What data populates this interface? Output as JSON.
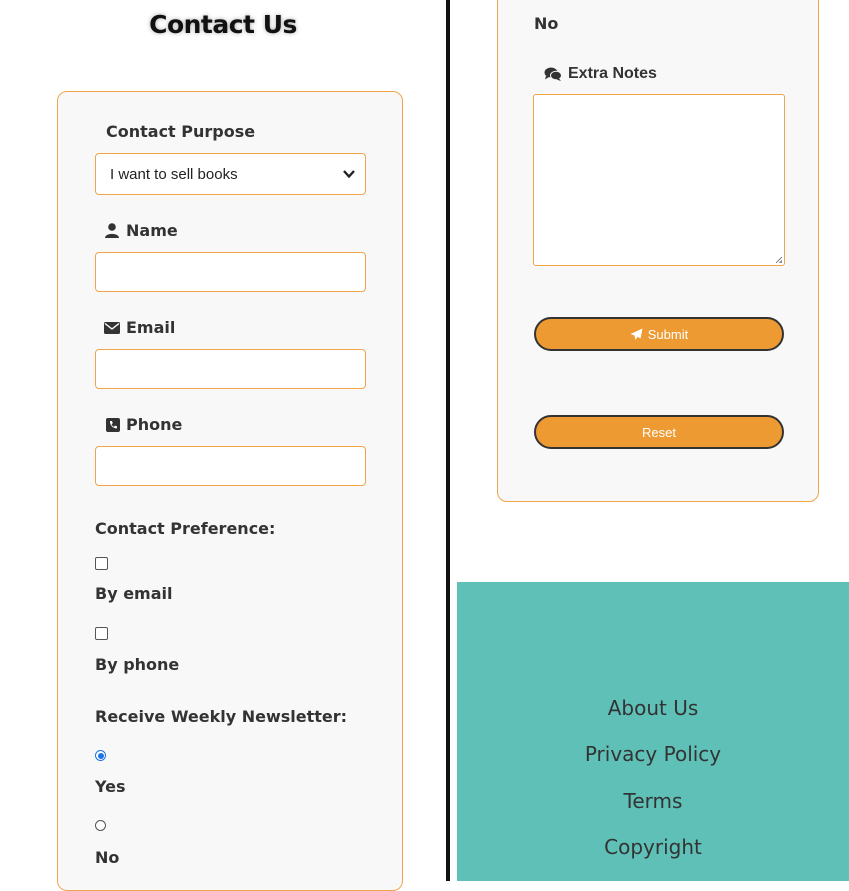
{
  "title": "Contact Us",
  "form": {
    "purpose_label": "Contact Purpose",
    "purpose_selected": "I want to sell books",
    "name_label": "Name",
    "name_value": "",
    "email_label": "Email",
    "email_value": "",
    "phone_label": "Phone",
    "phone_value": "",
    "contact_pref_label": "Contact Preference:",
    "pref_options": [
      "By email",
      "By phone"
    ],
    "newsletter_label": "Receive Weekly Newsletter:",
    "newsletter_options": [
      "Yes",
      "No"
    ],
    "newsletter_selected": "Yes",
    "notes_label": "Extra Notes",
    "notes_value": "",
    "submit_label": "Submit",
    "reset_label": "Reset"
  },
  "right_top_text": "No",
  "footer": {
    "links": [
      "About Us",
      "Privacy Policy",
      "Terms",
      "Copyright"
    ]
  },
  "colors": {
    "accent": "#ee9a33",
    "border": "#f0a54a",
    "footer_bg": "#5fc0b8",
    "radio_selected": "#1a73e8"
  },
  "icons": {
    "name": "user-icon",
    "email": "envelope-icon",
    "phone": "phone-square-icon",
    "notes": "comments-icon",
    "submit": "paper-plane-icon",
    "select": "chevron-down-icon"
  }
}
